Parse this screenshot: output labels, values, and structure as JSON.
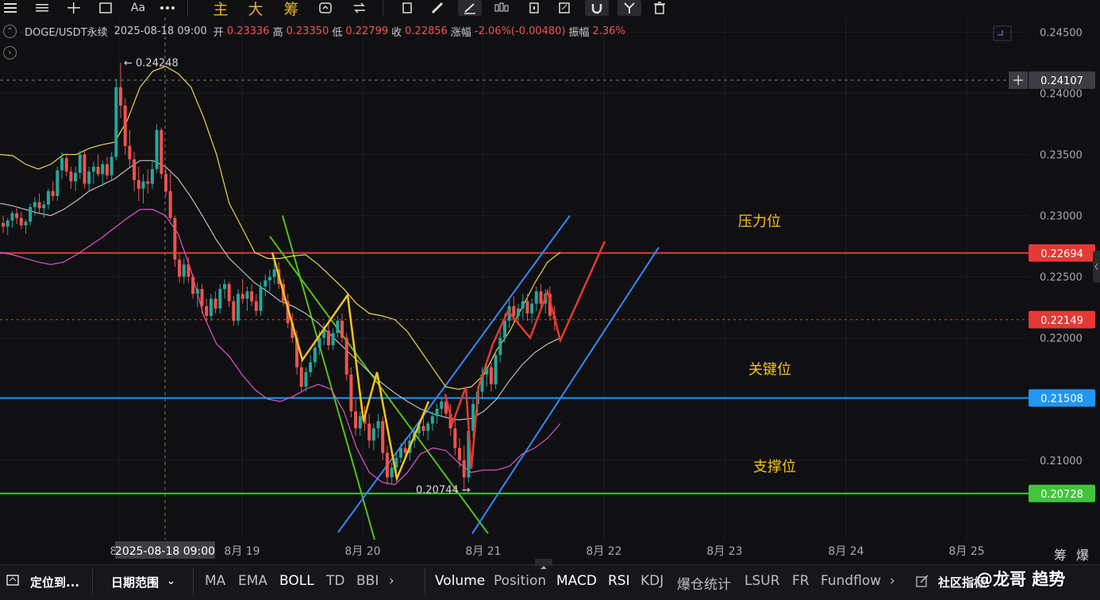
{
  "toolbar": {
    "font_label": "Aa",
    "gold_labels": [
      "主",
      "大",
      "筹"
    ]
  },
  "symbol_bar": {
    "symbol": "DOGE/USDT永续",
    "datetime": "2025-08-18 09:00",
    "open_label": "开",
    "open_value": "0.23336",
    "high_label": "高",
    "high_value": "0.23350",
    "low_label": "低",
    "low_value": "0.22799",
    "close_label": "收",
    "close_value": "0.22856",
    "change_label": "涨幅",
    "change_value": "-2.06%(-0.00480)",
    "amplitude_label": "振幅",
    "amplitude_value": "2.36%"
  },
  "colors": {
    "up": "#26a69a",
    "down": "#ef5350",
    "boll_upper": "#e6d74b",
    "boll_mid": "#bdbdbd",
    "boll_lower": "#e056c8",
    "resistance": "#e53935",
    "key": "#2196f3",
    "support": "#43c43d",
    "channel_down": "#54c21a",
    "channel_up": "#2f8bff",
    "zigzag_yellow": "#f5c518",
    "zigzag_red": "#e53935"
  },
  "chart_data": {
    "type": "candlestick",
    "y_axis": {
      "range": [
        0.2035,
        0.2462
      ],
      "ticks": [
        "0.24500",
        "0.24000",
        "0.23500",
        "0.23000",
        "0.22500",
        "0.22000",
        "0.21000"
      ]
    },
    "x_axis": {
      "ticks": [
        "8月",
        "8月 19",
        "8月 20",
        "8月 21",
        "8月 22",
        "8月 23",
        "8月 24",
        "8月 25"
      ],
      "crosshair_label": "2025-08-18 09:00"
    },
    "price_tags": [
      {
        "value": 0.24107,
        "label": "0.24107",
        "kind": "crosshair"
      },
      {
        "value": 0.22694,
        "label": "0.22694",
        "kind": "resistance"
      },
      {
        "value": 0.22149,
        "label": "0.22149",
        "kind": "current"
      },
      {
        "value": 0.21508,
        "label": "0.21508",
        "kind": "key"
      },
      {
        "value": 0.20728,
        "label": "0.20728",
        "kind": "support"
      }
    ],
    "levels": [
      {
        "name": "压力位",
        "value": 0.22694
      },
      {
        "name": "关键位",
        "value": 0.21508
      },
      {
        "name": "支撑位",
        "value": 0.20728
      }
    ],
    "annotations": [
      {
        "text": "← 0.24248",
        "value": 0.24248
      },
      {
        "text": "0.20744 →",
        "value": 0.20744
      }
    ],
    "candles": [
      [
        0.2294,
        0.23,
        0.2286,
        0.2291
      ],
      [
        0.2291,
        0.2298,
        0.2284,
        0.2296
      ],
      [
        0.2296,
        0.2304,
        0.229,
        0.2302
      ],
      [
        0.2302,
        0.2306,
        0.2293,
        0.2298
      ],
      [
        0.2298,
        0.2303,
        0.2289,
        0.2292
      ],
      [
        0.2292,
        0.2297,
        0.2285,
        0.2295
      ],
      [
        0.2295,
        0.231,
        0.2292,
        0.2307
      ],
      [
        0.2307,
        0.2315,
        0.23,
        0.2311
      ],
      [
        0.2311,
        0.2318,
        0.2302,
        0.2306
      ],
      [
        0.2306,
        0.2312,
        0.2298,
        0.2309
      ],
      [
        0.2309,
        0.2322,
        0.2305,
        0.232
      ],
      [
        0.232,
        0.2328,
        0.2312,
        0.2316
      ],
      [
        0.2316,
        0.234,
        0.2312,
        0.2337
      ],
      [
        0.2337,
        0.2352,
        0.233,
        0.2347
      ],
      [
        0.2347,
        0.235,
        0.2332,
        0.2336
      ],
      [
        0.2336,
        0.234,
        0.2322,
        0.2328
      ],
      [
        0.2328,
        0.234,
        0.232,
        0.2335
      ],
      [
        0.2335,
        0.2353,
        0.233,
        0.235
      ],
      [
        0.235,
        0.2353,
        0.2322,
        0.2326
      ],
      [
        0.2326,
        0.234,
        0.232,
        0.2336
      ],
      [
        0.2336,
        0.2344,
        0.2326,
        0.234
      ],
      [
        0.234,
        0.235,
        0.2332,
        0.2334
      ],
      [
        0.2334,
        0.2345,
        0.2324,
        0.2342
      ],
      [
        0.2342,
        0.2348,
        0.233,
        0.2333
      ],
      [
        0.2333,
        0.2352,
        0.2329,
        0.2348
      ],
      [
        0.2348,
        0.2412,
        0.2345,
        0.2405
      ],
      [
        0.2405,
        0.2425,
        0.238,
        0.239
      ],
      [
        0.239,
        0.2396,
        0.235,
        0.2357
      ],
      [
        0.2357,
        0.237,
        0.234,
        0.2346
      ],
      [
        0.2346,
        0.2352,
        0.232,
        0.2329
      ],
      [
        0.2329,
        0.234,
        0.2312,
        0.2322
      ],
      [
        0.2322,
        0.2334,
        0.231,
        0.2328
      ],
      [
        0.2328,
        0.2338,
        0.2318,
        0.2326
      ],
      [
        0.2326,
        0.2345,
        0.2322,
        0.2338
      ],
      [
        0.2338,
        0.2375,
        0.2335,
        0.237
      ],
      [
        0.237,
        0.2372,
        0.233,
        0.2334
      ],
      [
        0.2334,
        0.234,
        0.2316,
        0.232
      ],
      [
        0.232,
        0.2335,
        0.2296,
        0.2298
      ],
      [
        0.2298,
        0.23,
        0.2258,
        0.2264
      ],
      [
        0.2264,
        0.227,
        0.2245,
        0.225
      ],
      [
        0.225,
        0.2265,
        0.2244,
        0.226
      ],
      [
        0.226,
        0.2266,
        0.2245,
        0.225
      ],
      [
        0.225,
        0.2252,
        0.2232,
        0.2236
      ],
      [
        0.2236,
        0.2245,
        0.2225,
        0.224
      ],
      [
        0.224,
        0.2244,
        0.222,
        0.2226
      ],
      [
        0.2226,
        0.2232,
        0.2212,
        0.2218
      ],
      [
        0.2218,
        0.2236,
        0.2214,
        0.2232
      ],
      [
        0.2232,
        0.2238,
        0.222,
        0.2224
      ],
      [
        0.2224,
        0.2244,
        0.222,
        0.224
      ],
      [
        0.224,
        0.2248,
        0.2232,
        0.2244
      ],
      [
        0.2244,
        0.2246,
        0.2225,
        0.223
      ],
      [
        0.223,
        0.2234,
        0.221,
        0.2214
      ],
      [
        0.2214,
        0.224,
        0.221,
        0.2236
      ],
      [
        0.2236,
        0.2248,
        0.2228,
        0.2232
      ],
      [
        0.2232,
        0.2242,
        0.2222,
        0.2238
      ],
      [
        0.2238,
        0.2244,
        0.2226,
        0.223
      ],
      [
        0.223,
        0.2236,
        0.2218,
        0.2222
      ],
      [
        0.2222,
        0.2246,
        0.2218,
        0.2242
      ],
      [
        0.2242,
        0.2252,
        0.2234,
        0.2247
      ],
      [
        0.2247,
        0.2256,
        0.2238,
        0.225
      ],
      [
        0.225,
        0.2266,
        0.2244,
        0.2256
      ],
      [
        0.2256,
        0.2262,
        0.224,
        0.2244
      ],
      [
        0.2244,
        0.2248,
        0.2226,
        0.223
      ],
      [
        0.223,
        0.2236,
        0.2208,
        0.2212
      ],
      [
        0.2212,
        0.222,
        0.2196,
        0.22
      ],
      [
        0.22,
        0.2206,
        0.217,
        0.2176
      ],
      [
        0.2176,
        0.2182,
        0.2156,
        0.216
      ],
      [
        0.216,
        0.2176,
        0.2156,
        0.2172
      ],
      [
        0.2172,
        0.2186,
        0.2168,
        0.218
      ],
      [
        0.218,
        0.2196,
        0.2176,
        0.2192
      ],
      [
        0.2192,
        0.2206,
        0.2186,
        0.22
      ],
      [
        0.22,
        0.2212,
        0.2194,
        0.2206
      ],
      [
        0.2206,
        0.2214,
        0.219,
        0.2194
      ],
      [
        0.2194,
        0.2208,
        0.219,
        0.2204
      ],
      [
        0.2204,
        0.2218,
        0.22,
        0.2214
      ],
      [
        0.2214,
        0.222,
        0.2196,
        0.22
      ],
      [
        0.22,
        0.2204,
        0.2165,
        0.217
      ],
      [
        0.217,
        0.2176,
        0.2135,
        0.214
      ],
      [
        0.214,
        0.215,
        0.212,
        0.2126
      ],
      [
        0.2126,
        0.214,
        0.212,
        0.2136
      ],
      [
        0.2136,
        0.2144,
        0.2124,
        0.213
      ],
      [
        0.213,
        0.2138,
        0.211,
        0.2116
      ],
      [
        0.2116,
        0.213,
        0.2108,
        0.2126
      ],
      [
        0.2126,
        0.2138,
        0.2118,
        0.2132
      ],
      [
        0.2132,
        0.2136,
        0.21,
        0.2106
      ],
      [
        0.2106,
        0.2112,
        0.208,
        0.2086
      ],
      [
        0.2086,
        0.2098,
        0.208,
        0.2094
      ],
      [
        0.2094,
        0.2106,
        0.209,
        0.2102
      ],
      [
        0.2102,
        0.2114,
        0.2098,
        0.211
      ],
      [
        0.211,
        0.2118,
        0.2102,
        0.2106
      ],
      [
        0.2106,
        0.212,
        0.21,
        0.2116
      ],
      [
        0.2116,
        0.2126,
        0.211,
        0.2122
      ],
      [
        0.2122,
        0.2132,
        0.2116,
        0.2128
      ],
      [
        0.2128,
        0.2136,
        0.212,
        0.2124
      ],
      [
        0.2124,
        0.2132,
        0.2116,
        0.213
      ],
      [
        0.213,
        0.214,
        0.2124,
        0.2136
      ],
      [
        0.2136,
        0.2146,
        0.213,
        0.2142
      ],
      [
        0.2142,
        0.2152,
        0.2136,
        0.2148
      ],
      [
        0.2148,
        0.2154,
        0.2134,
        0.2138
      ],
      [
        0.2138,
        0.2146,
        0.212,
        0.2126
      ],
      [
        0.2126,
        0.2134,
        0.2104,
        0.211
      ],
      [
        0.211,
        0.2118,
        0.2094,
        0.21
      ],
      [
        0.21,
        0.2112,
        0.2074,
        0.2086
      ],
      [
        0.2086,
        0.213,
        0.2082,
        0.2124
      ],
      [
        0.2124,
        0.215,
        0.2118,
        0.2146
      ],
      [
        0.2146,
        0.216,
        0.2138,
        0.2156
      ],
      [
        0.2156,
        0.2176,
        0.215,
        0.217
      ],
      [
        0.217,
        0.2182,
        0.216,
        0.2176
      ],
      [
        0.2176,
        0.218,
        0.2156,
        0.2162
      ],
      [
        0.2162,
        0.219,
        0.2158,
        0.2186
      ],
      [
        0.2186,
        0.2206,
        0.218,
        0.22
      ],
      [
        0.22,
        0.222,
        0.2196,
        0.2214
      ],
      [
        0.2214,
        0.2232,
        0.2208,
        0.2226
      ],
      [
        0.2226,
        0.2234,
        0.2212,
        0.2218
      ],
      [
        0.2218,
        0.2228,
        0.221,
        0.2224
      ],
      [
        0.2224,
        0.2236,
        0.2216,
        0.223
      ],
      [
        0.223,
        0.2236,
        0.2214,
        0.222
      ],
      [
        0.222,
        0.2232,
        0.2212,
        0.2228
      ],
      [
        0.2228,
        0.2242,
        0.2222,
        0.2238
      ],
      [
        0.2238,
        0.2244,
        0.2224,
        0.2228
      ],
      [
        0.2228,
        0.224,
        0.222,
        0.2236
      ],
      [
        0.2236,
        0.2242,
        0.2214,
        0.2218
      ],
      [
        0.2218,
        0.2226,
        0.2206,
        0.2215
      ]
    ],
    "bollinger": {
      "upper": [
        0.235,
        0.2349,
        0.2342,
        0.2338,
        0.2342,
        0.235,
        0.235,
        0.2355,
        0.2358,
        0.236,
        0.2378,
        0.2405,
        0.2418,
        0.2422,
        0.2416,
        0.2405,
        0.238,
        0.235,
        0.231,
        0.229,
        0.227,
        0.2265,
        0.2265,
        0.2267,
        0.2268,
        0.226,
        0.225,
        0.224,
        0.2228,
        0.222,
        0.2218,
        0.2215,
        0.2205,
        0.219,
        0.2175,
        0.216,
        0.2158,
        0.216,
        0.217,
        0.219,
        0.2205,
        0.2225,
        0.2245,
        0.2262,
        0.227
      ],
      "mid": [
        0.231,
        0.2308,
        0.2305,
        0.2302,
        0.23,
        0.2305,
        0.2312,
        0.232,
        0.2325,
        0.233,
        0.2338,
        0.2345,
        0.2345,
        0.234,
        0.233,
        0.2315,
        0.2298,
        0.228,
        0.2265,
        0.2255,
        0.2245,
        0.2238,
        0.223,
        0.2226,
        0.222,
        0.2212,
        0.2202,
        0.2192,
        0.2182,
        0.2172,
        0.2163,
        0.2155,
        0.2148,
        0.2142,
        0.2138,
        0.2135,
        0.2133,
        0.2134,
        0.214,
        0.215,
        0.2165,
        0.2178,
        0.2188,
        0.2195,
        0.22
      ],
      "lower": [
        0.227,
        0.2268,
        0.2265,
        0.2262,
        0.226,
        0.2262,
        0.2268,
        0.2275,
        0.2282,
        0.229,
        0.2298,
        0.2305,
        0.2305,
        0.23,
        0.2285,
        0.2255,
        0.2218,
        0.2195,
        0.2185,
        0.217,
        0.2158,
        0.215,
        0.2148,
        0.2152,
        0.2158,
        0.2162,
        0.2158,
        0.214,
        0.211,
        0.209,
        0.2082,
        0.208,
        0.209,
        0.2105,
        0.211,
        0.2108,
        0.2098,
        0.209,
        0.2092,
        0.2092,
        0.2095,
        0.2105,
        0.211,
        0.2118,
        0.213
      ]
    },
    "zigzag_yellow": [
      [
        0.227
      ],
      [
        0.2182
      ],
      [
        0.2235
      ],
      [
        0.2132
      ],
      [
        0.2172
      ],
      [
        0.2085
      ],
      [
        0.2148
      ]
    ],
    "zigzag_red": [
      [
        0.2154
      ],
      [
        0.213
      ],
      [
        0.216
      ],
      [
        0.2093
      ],
      [
        0.216
      ],
      [
        0.2195
      ],
      [
        0.2222
      ],
      [
        0.22
      ],
      [
        0.2238
      ],
      [
        0.2198
      ],
      [
        0.2279
      ]
    ]
  },
  "bottom_bar": {
    "goto_label": "定位到...",
    "date_range_label": "日期范围",
    "main_indicators": [
      "MA",
      "EMA",
      "BOLL",
      "TD",
      "BBI"
    ],
    "sub_indicators": [
      "Volume",
      "Position",
      "MACD",
      "RSI",
      "KDJ",
      "爆仓统计",
      "LSUR",
      "FR",
      "Fundflow"
    ],
    "community_label": "社区指标",
    "arrow": "›"
  },
  "right_bottom_labels": [
    "筹",
    "爆"
  ],
  "watermark": "@龙哥 趋势"
}
